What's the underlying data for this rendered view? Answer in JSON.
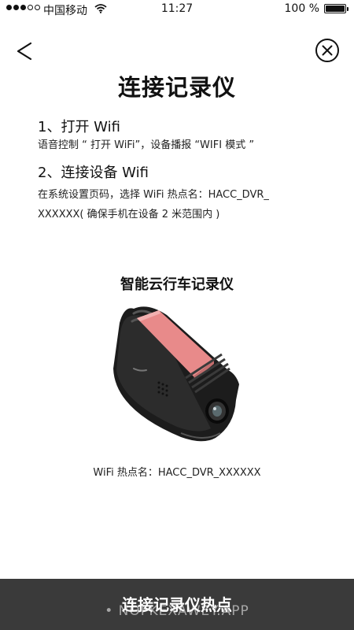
{
  "status_bar": {
    "carrier": "中国移动",
    "time": "11:27",
    "battery": "100 %"
  },
  "nav": {
    "back_icon": "chevron-left-icon",
    "close_icon": "close-circle-icon"
  },
  "page": {
    "title": "连接记录仪",
    "step1": {
      "heading": "1、打开 Wifi",
      "text": "语音控制 “ 打开 WiFi”，设备播报 “WIFI 模式 ”"
    },
    "step2": {
      "heading": "2、连接设备 Wifi",
      "text_line1": "在系统设置页码，选择 WiFi 热点名：HACC_DVR_",
      "text_line2": "XXXXXX( 确保手机在设备 2 米范围内 )"
    },
    "device_caption": "智能云行车记录仪",
    "ssid_caption": "WiFi 热点名：HACC_DVR_XXXXXX"
  },
  "footer": {
    "connect_button": "连接记录仪热点",
    "watermark": "• NOFKEXAWEY.APP"
  },
  "colors": {
    "button_bg": "#3a3a3a",
    "pad_pink": "#e88a8a"
  }
}
